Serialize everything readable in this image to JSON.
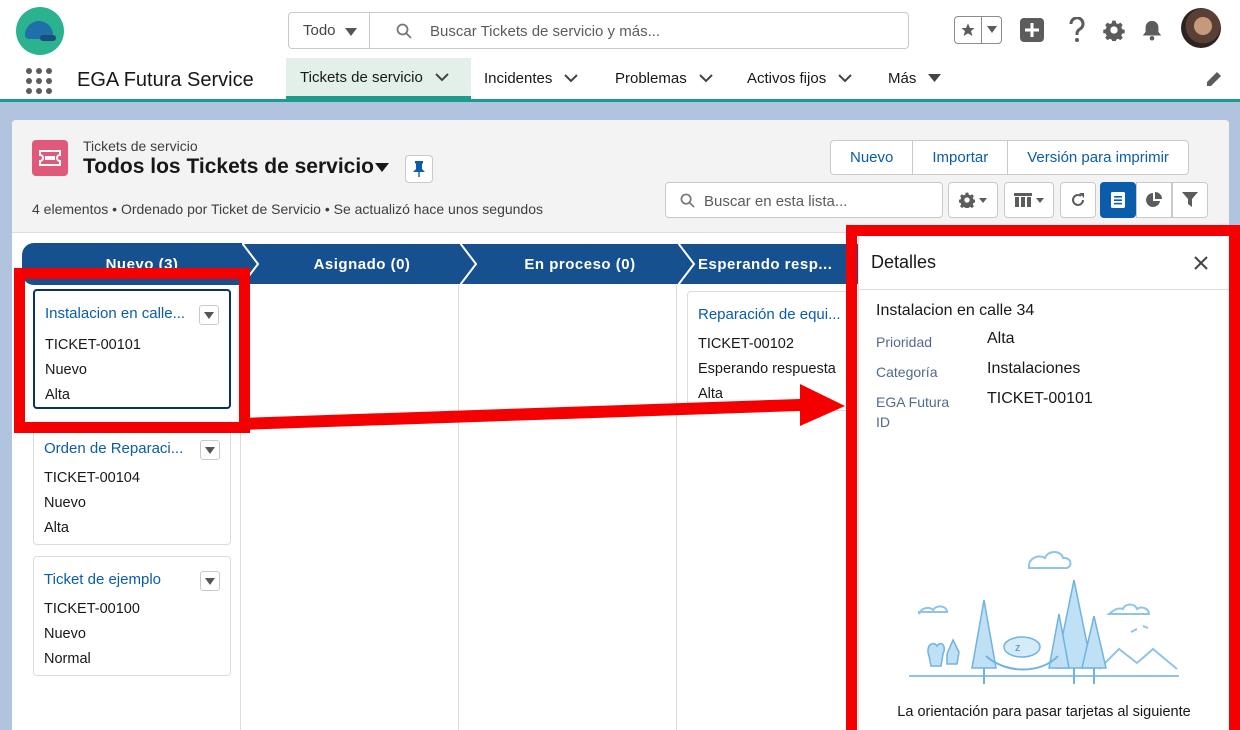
{
  "global_header": {
    "search_scope": "Todo",
    "search_placeholder": "Buscar Tickets de servicio y más..."
  },
  "nav": {
    "app_name": "EGA Futura Service",
    "items": [
      {
        "label": "Tickets de servicio",
        "active": true
      },
      {
        "label": "Incidentes"
      },
      {
        "label": "Problemas"
      },
      {
        "label": "Activos fijos"
      },
      {
        "label": "Más"
      }
    ]
  },
  "list_header": {
    "object_label": "Tickets de servicio",
    "list_title": "Todos los Tickets de servicio",
    "meta": "4 elementos • Ordenado por Ticket de Servicio • Se actualizó hace unos segundos",
    "buttons": [
      "Nuevo",
      "Importar",
      "Versión para imprimir"
    ],
    "search_placeholder": "Buscar en esta lista..."
  },
  "lanes": [
    {
      "title": "Nuevo   (3)"
    },
    {
      "title": "Asignado   (0)"
    },
    {
      "title": "En proceso   (0)"
    },
    {
      "title": "Esperando resp..."
    }
  ],
  "cards": {
    "nuevo": [
      {
        "title": "Instalacion en calle...",
        "id": "TICKET-00101",
        "status": "Nuevo",
        "priority": "Alta"
      },
      {
        "title": "Orden de Reparaci...",
        "id": "TICKET-00104",
        "status": "Nuevo",
        "priority": "Alta"
      },
      {
        "title": "Ticket de ejemplo",
        "id": "TICKET-00100",
        "status": "Nuevo",
        "priority": "Normal"
      }
    ],
    "esperando": [
      {
        "title": "Reparación de equi...",
        "id": "TICKET-00102",
        "status": "Esperando respuesta",
        "priority": "Alta"
      }
    ]
  },
  "details": {
    "title": "Detalles",
    "record_name": "Instalacion en calle 34",
    "fields": [
      {
        "label": "Prioridad",
        "value": "Alta"
      },
      {
        "label": "Categoría",
        "value": "Instalaciones"
      },
      {
        "label": "EGA Futura ID",
        "value": "TICKET-00101"
      }
    ],
    "footer_text": "La orientación para pasar tarjetas al siguiente"
  },
  "colors": {
    "lane_blue": "#16508f",
    "accent_teal": "#1d9b8e",
    "link_blue": "#0b5cab",
    "annotation_red": "#f40000"
  }
}
